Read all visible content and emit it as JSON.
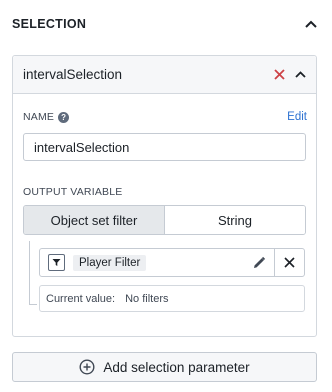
{
  "section": {
    "title": "SELECTION"
  },
  "card": {
    "title": "intervalSelection",
    "name_label": "NAME",
    "edit_label": "Edit",
    "name_value": "intervalSelection",
    "output_label": "OUTPUT VARIABLE",
    "output_options": [
      {
        "label": "Object set filter",
        "active": true
      },
      {
        "label": "String",
        "active": false
      }
    ],
    "filter": {
      "tag": "Player Filter"
    },
    "current_value": {
      "label": "Current value:",
      "value": "No filters"
    }
  },
  "add_button": {
    "label": "Add selection parameter"
  },
  "colors": {
    "remove_red": "#cd4246",
    "text": "#1c2127",
    "link": "#2d72d2"
  },
  "icons": [
    "chevron-up-icon",
    "close-icon",
    "help-icon",
    "filter-icon",
    "pencil-icon",
    "plus-circle-icon"
  ]
}
